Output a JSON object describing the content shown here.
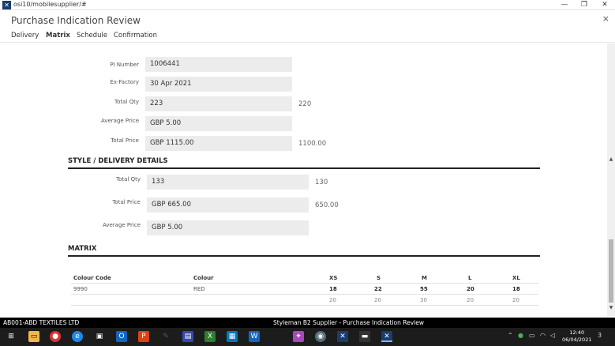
{
  "window": {
    "url_title": "osi10/mobilesupplier/#",
    "minimize_glyph": "—",
    "restore_glyph": "❐",
    "close_glyph": "✕"
  },
  "page": {
    "title": "Purchase Indication Review",
    "close_glyph": "×"
  },
  "tabs": [
    {
      "label": "Delivery",
      "active": false
    },
    {
      "label": "Matrix",
      "active": true
    },
    {
      "label": "Schedule",
      "active": false
    },
    {
      "label": "Confirmation",
      "active": false
    }
  ],
  "summary": {
    "pi_number_label": "PI Number",
    "pi_number": "1006441",
    "ex_factory_label": "Ex-Factory",
    "ex_factory": "30 Apr 2021",
    "total_qty_label": "Total Qty",
    "total_qty": "223",
    "total_qty_extra": "220",
    "avg_price_label": "Average Price",
    "avg_price": "GBP 5.00",
    "total_price_label": "Total Price",
    "total_price": "GBP 1115.00",
    "total_price_extra": "1100.00"
  },
  "style_delivery": {
    "heading": "STYLE / DELIVERY DETAILS",
    "total_qty_label": "Total Qty",
    "total_qty": "133",
    "total_qty_extra": "130",
    "total_price_label": "Total Price",
    "total_price": "GBP 665.00",
    "total_price_extra": "650.00",
    "avg_price_label": "Average Price",
    "avg_price": "GBP 5.00"
  },
  "matrix": {
    "heading": "MATRIX",
    "col_colour_code": "Colour Code",
    "col_colour": "Colour",
    "sizes": [
      "XS",
      "S",
      "M",
      "L",
      "XL"
    ],
    "row": {
      "colour_code": "9990",
      "colour": "RED",
      "qty": [
        "18",
        "22",
        "55",
        "20",
        "18"
      ],
      "ref": [
        "20",
        "20",
        "30",
        "20",
        "20"
      ]
    }
  },
  "statusbar": {
    "company": "AB001-ABD TEXTILES LTD",
    "app": "Styleman B2 Supplier - Purchase Indication Review"
  },
  "taskbar": {
    "time": "12:40",
    "date": "06/04/2021",
    "notif_count": "3"
  }
}
